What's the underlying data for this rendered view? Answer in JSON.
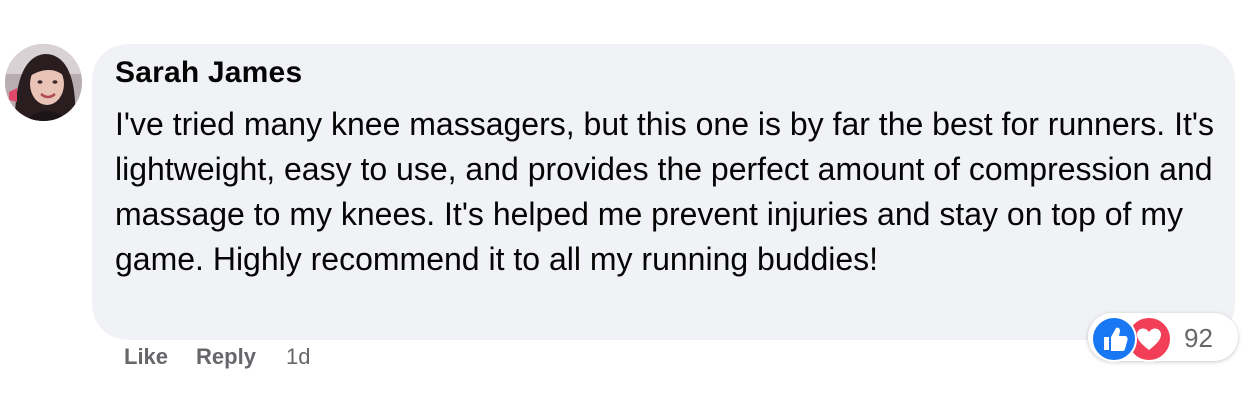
{
  "comment": {
    "author": "Sarah James",
    "text": "I've tried many knee massagers, but this one is by far the best for runners. It's lightweight, easy to use, and provides the perfect amount of compression and massage to my knees. It's helped me prevent injuries and stay on top of my game. Highly recommend it to all my running buddies!",
    "actions": {
      "like_label": "Like",
      "reply_label": "Reply",
      "timestamp": "1d"
    },
    "reactions": {
      "types": [
        "like-icon",
        "love-icon"
      ],
      "count": "92"
    }
  },
  "colors": {
    "bubble_bg": "#f0f2f5",
    "like_blue": "#1877f2",
    "love_red": "#f33e58",
    "meta_gray": "#65676b"
  }
}
